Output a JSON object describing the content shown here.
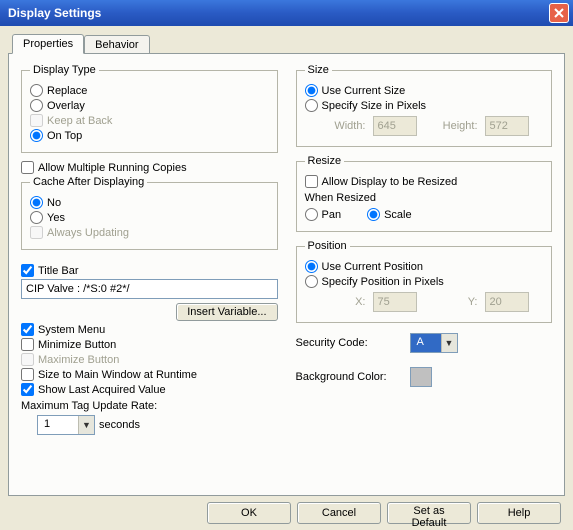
{
  "window": {
    "title": "Display Settings"
  },
  "tabs": {
    "properties": "Properties",
    "behavior": "Behavior"
  },
  "displayType": {
    "legend": "Display Type",
    "replace": "Replace",
    "overlay": "Overlay",
    "keepAtBack": "Keep at Back",
    "onTop": "On Top"
  },
  "allowMultiple": "Allow Multiple Running Copies",
  "cache": {
    "legend": "Cache After Displaying",
    "no": "No",
    "yes": "Yes",
    "always": "Always Updating"
  },
  "titleBar": {
    "check": "Title Bar",
    "value": "CIP Valve : /*S:0 #2*/",
    "insert": "Insert Variable..."
  },
  "systemMenu": "System Menu",
  "minimize": "Minimize Button",
  "maximize": "Maximize Button",
  "sizeMain": "Size to Main Window at Runtime",
  "showLast": "Show Last Acquired Value",
  "maxTag": {
    "label": "Maximum Tag Update Rate:",
    "value": "1",
    "unit": "seconds"
  },
  "size": {
    "legend": "Size",
    "useCurrent": "Use Current Size",
    "specify": "Specify Size in Pixels",
    "widthLabel": "Width:",
    "widthValue": "645",
    "heightLabel": "Height:",
    "heightValue": "572"
  },
  "resize": {
    "legend": "Resize",
    "allow": "Allow Display to be Resized",
    "when": "When Resized",
    "pan": "Pan",
    "scale": "Scale"
  },
  "position": {
    "legend": "Position",
    "useCurrent": "Use Current Position",
    "specify": "Specify Position in Pixels",
    "xLabel": "X:",
    "xValue": "75",
    "yLabel": "Y:",
    "yValue": "20"
  },
  "security": {
    "label": "Security Code:",
    "value": "A"
  },
  "bgcolor": {
    "label": "Background Color:"
  },
  "buttons": {
    "ok": "OK",
    "cancel": "Cancel",
    "setDefault": "Set as Default",
    "help": "Help"
  }
}
